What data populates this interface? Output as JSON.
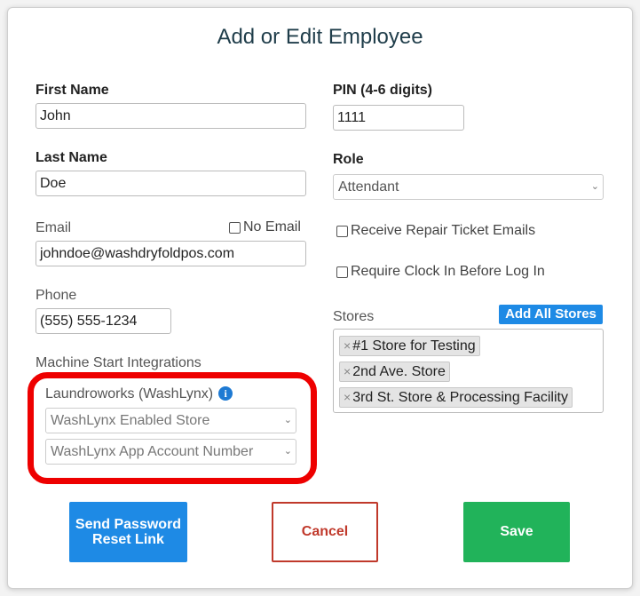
{
  "modal": {
    "title": "Add or Edit Employee"
  },
  "first_name": {
    "label": "First Name",
    "value": "John"
  },
  "last_name": {
    "label": "Last Name",
    "value": "Doe"
  },
  "email": {
    "label": "Email",
    "value": "johndoe@washdryfoldpos.com",
    "no_email_label": "No Email",
    "no_email_checked": false
  },
  "phone": {
    "label": "Phone",
    "value": "(555) 555-1234"
  },
  "pin": {
    "label": "PIN (4-6 digits)",
    "value": "1111"
  },
  "role": {
    "label": "Role",
    "value": "Attendant"
  },
  "repair_emails": {
    "label": "Receive Repair Ticket Emails",
    "checked": false
  },
  "clock_in": {
    "label": "Require Clock In Before Log In",
    "checked": false
  },
  "stores": {
    "label": "Stores",
    "add_all_label": "Add All Stores",
    "selected": [
      "#1 Store for Testing",
      "2nd Ave. Store",
      "3rd St. Store & Processing Facility"
    ],
    "remove_glyph": "×"
  },
  "integrations": {
    "section_label": "Machine Start Integrations",
    "provider_label": "Laundroworks (WashLynx)",
    "info_glyph": "i",
    "enabled_store_placeholder": "WashLynx Enabled Store",
    "account_number_placeholder": "WashLynx App Account Number",
    "highlight_color": "#ee0000"
  },
  "buttons": {
    "send_reset": "Send Password\nReset Link",
    "cancel": "Cancel",
    "save": "Save"
  },
  "colors": {
    "primary": "#1e8ae5",
    "danger": "#c0392b",
    "success": "#21b35a",
    "title": "#1f3d4a"
  },
  "icons": {
    "chevron": "chevron-down-icon",
    "info": "info-icon",
    "remove": "remove-tag-icon"
  }
}
